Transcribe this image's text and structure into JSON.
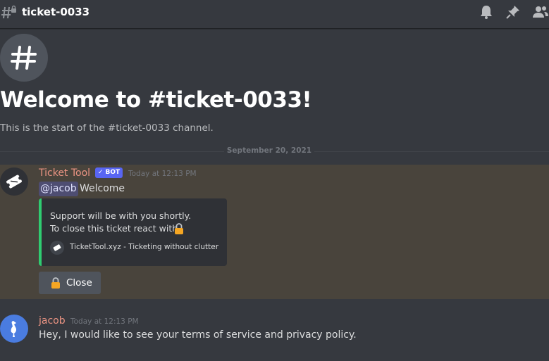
{
  "header": {
    "channel_name": "ticket-0033",
    "icons": [
      "hashtag-lock-icon",
      "bell-icon",
      "pin-icon",
      "members-icon"
    ]
  },
  "welcome": {
    "title": "Welcome to #ticket-0033!",
    "subtitle": "This is the start of the #ticket-0033 channel.",
    "icon": "hashtag-icon"
  },
  "date_divider": "September 20, 2021",
  "messages": [
    {
      "author": "Ticket Tool",
      "badge": "BOT",
      "timestamp": "Today at 12:13 PM",
      "mention": "@jacob",
      "text": "Welcome",
      "embed": {
        "line1": "Support will be with you shortly.",
        "line2": "To close this ticket react with",
        "footer": "TicketTool.xyz - Ticketing without clutter",
        "accent_color": "#2fcc71"
      },
      "button": {
        "label": "Close",
        "icon": "lock-icon"
      }
    },
    {
      "author": "jacob",
      "timestamp": "Today at 12:13 PM",
      "text": "Hey, I would like to see your terms of service and privacy policy."
    }
  ],
  "colors": {
    "background": "#36393f",
    "highlight": "#49443c",
    "author": "#eb9483",
    "bot_badge": "#5865f2",
    "lock": "#f5a623"
  }
}
